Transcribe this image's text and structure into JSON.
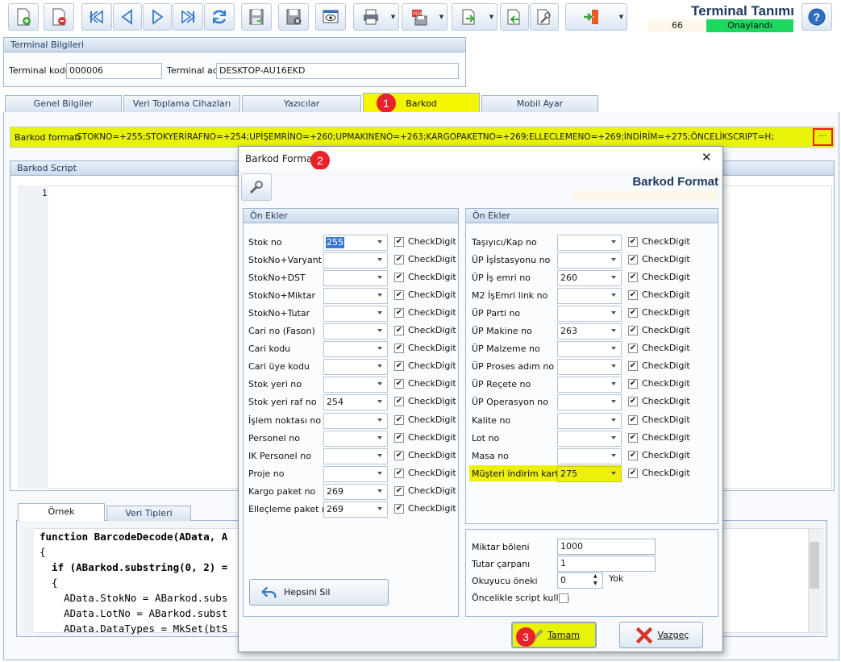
{
  "app": {
    "title": "Terminal Tanımı",
    "count": "66",
    "status": "Onaylandı",
    "status_color": "#1ed760"
  },
  "toolbar": {
    "icons": [
      "add-document-icon",
      "delete-document-icon",
      "first-record-icon",
      "previous-record-icon",
      "next-record-icon",
      "last-record-icon",
      "refresh-icon",
      "save-icon",
      "save-disabled-icon",
      "preview-icon",
      "print-icon",
      "pdf-icon",
      "export-icon",
      "import-icon",
      "settings-icon",
      "exit-door-icon",
      "help-icon"
    ]
  },
  "terminal_info": {
    "header": "Terminal Bilgileri",
    "code_label": "Terminal kodu",
    "code_value": "000006",
    "name_label": "Terminal adı",
    "name_value": "DESKTOP-AU16EKD"
  },
  "tabs": [
    {
      "label": "Genel Bilgiler"
    },
    {
      "label": "Veri Toplama Cihazları"
    },
    {
      "label": "Yazıcılar"
    },
    {
      "label": "Barkod"
    },
    {
      "label": "Mobil Ayar"
    }
  ],
  "barcode": {
    "format_label": "Barkod formatı",
    "format_value": "STOKNO=+255;STOKYERİRAFNO=+254;UPİŞEMRİNO=+260;UPMAKINENO=+263;KARGOPAKETNO=+269;ELLECLEMENO=+269;İNDİRİM=+275;ÖNCELİKSCRIPT=H;",
    "ellipsis": "...",
    "script_header": "Barkod Script",
    "line_number": "1"
  },
  "example_tabs": [
    {
      "label": "Örnek"
    },
    {
      "label": "Veri Tipleri"
    }
  ],
  "code_lines": [
    "function BarcodeDecode(AData, A",
    "{",
    "  if (ABarkod.substring(0, 2) =",
    "  {",
    "    AData.StokNo = ABarkod.subs",
    "    AData.LotNo = ABarkod.subst",
    "    AData.DataTypes = MkSet(btS"
  ],
  "badges": [
    "1",
    "2",
    "3"
  ],
  "dialog": {
    "title": "Barkod Format",
    "heading": "Barkod Format",
    "close": "✕",
    "left_header": "Ön Ekler",
    "right_header": "Ön Ekler",
    "checkdigit_label": "CheckDigit",
    "left_rows": [
      {
        "label": "Stok no",
        "value": "255",
        "checked": true
      },
      {
        "label": "StokNo+Varyant",
        "value": "",
        "checked": true
      },
      {
        "label": "StokNo+DST",
        "value": "",
        "checked": true
      },
      {
        "label": "StokNo+Miktar",
        "value": "",
        "checked": true
      },
      {
        "label": "StokNo+Tutar",
        "value": "",
        "checked": true
      },
      {
        "label": "Cari no (Fason)",
        "value": "",
        "checked": true
      },
      {
        "label": "Cari kodu",
        "value": "",
        "checked": true
      },
      {
        "label": "Cari üye kodu",
        "value": "",
        "checked": true
      },
      {
        "label": "Stok yeri no",
        "value": "",
        "checked": true
      },
      {
        "label": "Stok yeri raf no",
        "value": "254",
        "checked": true
      },
      {
        "label": "İşlem noktası no",
        "value": "",
        "checked": true
      },
      {
        "label": "Personel no",
        "value": "",
        "checked": true
      },
      {
        "label": "IK Personel no",
        "value": "",
        "checked": true
      },
      {
        "label": "Proje no",
        "value": "",
        "checked": true
      },
      {
        "label": "Kargo paket no",
        "value": "269",
        "checked": true
      },
      {
        "label": "Elleçleme paket no",
        "value": "269",
        "checked": true
      }
    ],
    "right_rows": [
      {
        "label": "Taşıyıcı/Kap no",
        "value": "",
        "checked": true
      },
      {
        "label": "ÜP İşİstasyonu no",
        "value": "",
        "checked": true
      },
      {
        "label": "ÜP İş emri no",
        "value": "260",
        "checked": true
      },
      {
        "label": "M2 İşEmri link no",
        "value": "",
        "checked": true
      },
      {
        "label": "ÜP Parti no",
        "value": "",
        "checked": true
      },
      {
        "label": "ÜP Makine no",
        "value": "263",
        "checked": true
      },
      {
        "label": "ÜP Malzeme no",
        "value": "",
        "checked": true
      },
      {
        "label": "ÜP Proses adım no",
        "value": "",
        "checked": true
      },
      {
        "label": "ÜP Reçete no",
        "value": "",
        "checked": true
      },
      {
        "label": "ÜP Operasyon no",
        "value": "",
        "checked": true
      },
      {
        "label": "Kalite no",
        "value": "",
        "checked": true
      },
      {
        "label": "Lot no",
        "value": "",
        "checked": true
      },
      {
        "label": "Masa no",
        "value": "",
        "checked": true
      },
      {
        "label": "Müşteri indirim kartı",
        "value": "275",
        "checked": true
      }
    ],
    "misc": {
      "miktar_label": "Miktar böleni",
      "miktar_value": "1000",
      "tutar_label": "Tutar çarpanı",
      "tutar_value": "1",
      "okuyucu_label": "Okuyucu öneki",
      "okuyucu_value": "0",
      "okuyucu_suffix": "Yok",
      "oncelik_label": "Öncelikle script kullan"
    },
    "clear_all": "Hepsini Sil",
    "ok": "Tamam",
    "cancel": "Vazgeç"
  }
}
